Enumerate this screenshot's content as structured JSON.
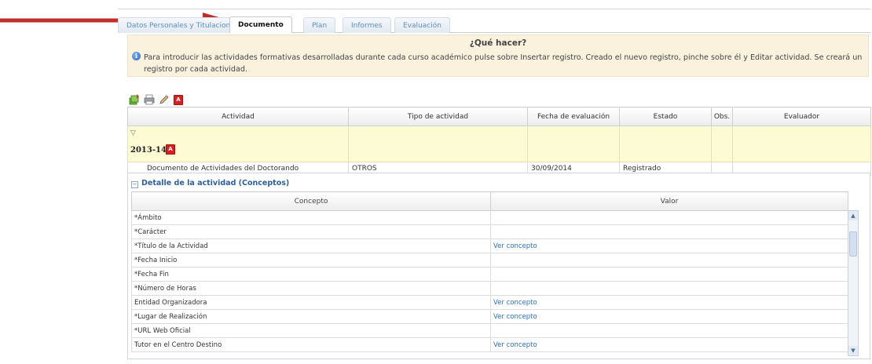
{
  "tabs": [
    {
      "label": "Datos Personales y Titulaciones"
    },
    {
      "label": "Documento"
    },
    {
      "label": "Plan"
    },
    {
      "label": "Informes"
    },
    {
      "label": "Evaluación"
    }
  ],
  "help": {
    "title": "¿Qué hacer?",
    "text": "Para introducir las actividades formativas desarrolladas durante cada curso académico pulse sobre Insertar registro. Creado el nuevo registro, pinche sobre él y Editar actividad. Se creará un registro por cada actividad."
  },
  "toolbar": {
    "icons": [
      "insert-record-icon",
      "print-icon",
      "edit-icon",
      "pdf-icon"
    ],
    "pdf_label": "A"
  },
  "main_table": {
    "headers": [
      "Actividad",
      "Tipo de actividad",
      "Fecha de evaluación",
      "Estado",
      "Obs.",
      "Evaluador"
    ],
    "group": {
      "toggle": "▽",
      "year": "2013-14"
    },
    "rows": [
      {
        "actividad": "Documento de Actividades del Doctorando",
        "tipo": "OTROS",
        "fecha": "30/09/2014",
        "estado": "Registrado",
        "obs": "",
        "evaluador": ""
      }
    ]
  },
  "detail": {
    "collapse": "−",
    "title": "Detalle de la actividad (Conceptos)",
    "headers": [
      "Concepto",
      "Valor"
    ],
    "rows": [
      {
        "concepto": "*Ámbito",
        "valor": ""
      },
      {
        "concepto": "*Carácter",
        "valor": ""
      },
      {
        "concepto": "*Título de la Actividad",
        "valor": "Ver concepto"
      },
      {
        "concepto": "*Fecha Inicio",
        "valor": ""
      },
      {
        "concepto": "*Fecha Fin",
        "valor": ""
      },
      {
        "concepto": "*Número de Horas",
        "valor": ""
      },
      {
        "concepto": "Entidad Organizadora",
        "valor": "Ver concepto"
      },
      {
        "concepto": "*Lugar de Realización",
        "valor": "Ver concepto"
      },
      {
        "concepto": "*URL Web Oficial",
        "valor": ""
      },
      {
        "concepto": "Tutor en el Centro Destino",
        "valor": "Ver concepto"
      }
    ],
    "scroll_up": "▲",
    "scroll_down": "▼"
  },
  "colors": {
    "arrow": "#c0302a",
    "help_bg": "#fbf2de",
    "group_bg": "#fdfbd3",
    "link": "#2a6fc0"
  }
}
